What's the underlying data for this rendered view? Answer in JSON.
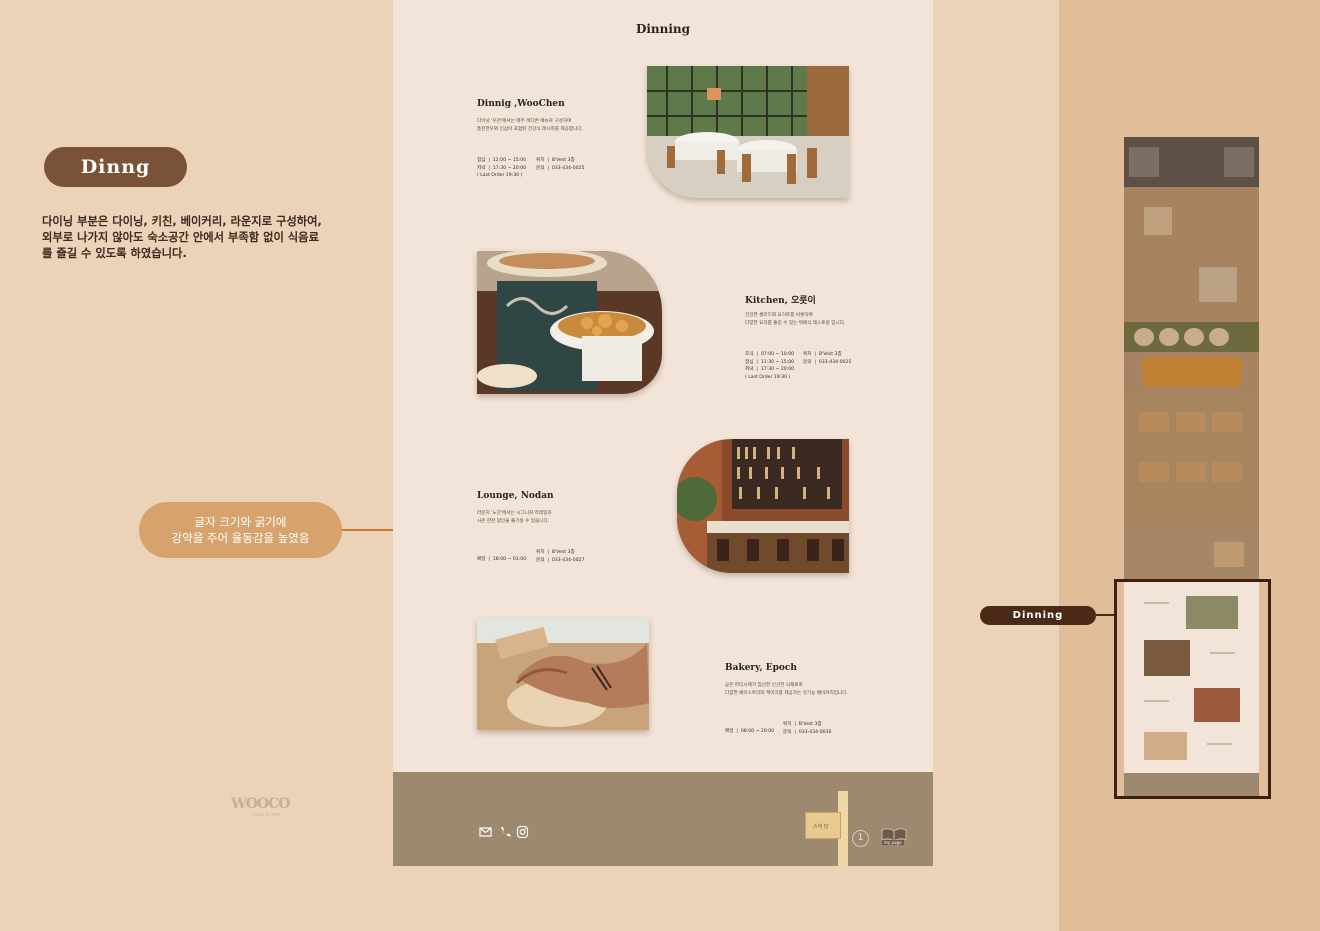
{
  "left_panel": {
    "title": "Dinng",
    "description": "다이닝 부분은 다이닝, 키친, 베이커리, 라운지로 구성하여, 외부로 나가지 않아도 숙소공간 안에서 부족함 없이 식음료를 즐길 수 있도록 하였습니다.",
    "note": "글자 크기와 굵기에\n강약을 주어 율동감을 높였음"
  },
  "page": {
    "title": "Dinning",
    "sections": [
      {
        "title": "Dinnig ,WooChen",
        "desc": "다이닝 '우천'에서는 매주 색다른 메뉴로 구성하여\n풍천한우와 인삼이 포함된 건강식 레시피를 제공합니다.",
        "hours": "점심  |  12:00 ~ 15:00\n저녁  |  17:30 ~ 20:00\n( Last Order 19:30 )",
        "loc": "위치  |  B'Vest 3층\n문의  |  033-434-0025"
      },
      {
        "title": "Kitchen, 오릇이",
        "desc": "건강한 셀러드와 요거트를 비롯하여\n다양한 요리를 즐길 수 있는 뷔페식 레스토랑 입니다.",
        "hours": "조식  |  07:00 ~ 10:00\n점심  |  11:30 ~ 15:00\n저녁  |  17:30 ~ 20:00\n( Last Order 19:30 )",
        "loc": "위치  |  B'Vest 3층\n문의  |  033-434-0025"
      },
      {
        "title": "Lounge, Nodan",
        "desc": "라운지 '노단'에서는 시그니처 칵테일과\n사은 한잔 맞인을 즐기실 수 있습니다.",
        "hours": "매일  |  18:00 ~ 01:00",
        "loc": "위치  |  B'Vest 3층\n문의  |  033-434-0027"
      },
      {
        "title": "Bakery, Epoch",
        "desc": "곧은 파티시에가 엄선한 신선한 식재료로\n다양한 페이스트리와 케이크를 제공하는 유기농 베이커리입니다.",
        "hours": "매일  |  08:00 ~ 20:00",
        "loc": "위치  |  B'Vest 3층\n문의  |  033-434-0030"
      }
    ]
  },
  "footer": {
    "logo": "WOOCO",
    "logo_sub": "book & rest",
    "info": "강원도 홍천군 서면 마곡리 곤 161 (강대평일 1131)  |  Tel. 1588-1885\n사업자 등록번호. 111-87-67891  |  대표자씨. 정소은\n© 2024 WooSun Co. All Rights reserved.",
    "book_tab": "스낵 담",
    "circle": "1",
    "mypage": "my page",
    "icons": [
      "mail-icon",
      "phone-icon",
      "instagram-icon"
    ]
  },
  "thumbnail": {
    "tag": "Dinning"
  },
  "colors": {
    "background": "#ecd2b8",
    "right_panel": "#e2bd9a",
    "page": "#f2e4d8",
    "footer": "#9d8870",
    "accent_brown": "#7a5237",
    "accent_orange": "#d6a36c"
  }
}
